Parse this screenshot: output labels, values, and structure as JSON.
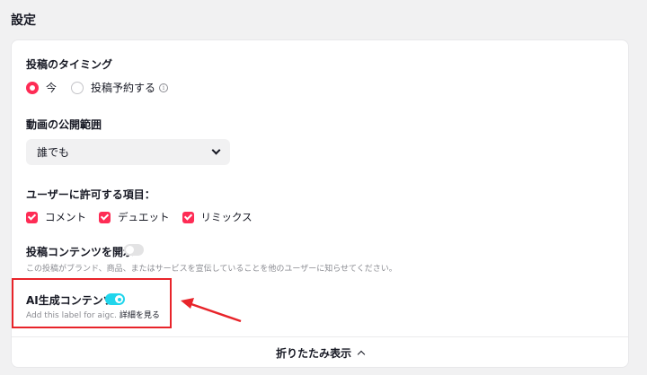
{
  "section": {
    "title": "設定"
  },
  "timing": {
    "label": "投稿のタイミング",
    "options": [
      {
        "label": "今",
        "checked": true
      },
      {
        "label": "投稿予約する",
        "checked": false
      }
    ],
    "info_icon": "info-icon"
  },
  "visibility": {
    "label": "動画の公開範囲",
    "selected": "誰でも",
    "chevron_icon": "chevron-down-icon"
  },
  "permissions": {
    "label": "ユーザーに許可する項目：",
    "items": [
      {
        "label": "コメント",
        "checked": true
      },
      {
        "label": "デュエット",
        "checked": true
      },
      {
        "label": "リミックス",
        "checked": true
      }
    ]
  },
  "disclose": {
    "label": "投稿コンテンツを開示",
    "enabled": false,
    "description": "この投稿がブランド、商品、またはサービスを宣伝していることを他のユーザーに知らせてください。"
  },
  "ai_content": {
    "label": "AI生成コンテンツ",
    "enabled": true,
    "description": "Add this label for aigc.",
    "link": "詳細を見る"
  },
  "collapse": {
    "label": "折りたたみ表示"
  },
  "annotation": {
    "color": "#e8242a"
  },
  "colors": {
    "accent": "#fe2c55",
    "toggle_on": "#20d5ec"
  }
}
